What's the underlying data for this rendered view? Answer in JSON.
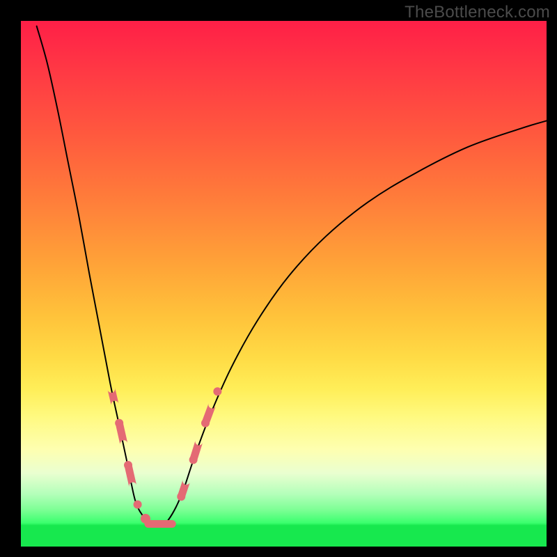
{
  "watermark": "TheBottleneck.com",
  "colors": {
    "background_frame": "#000000",
    "gradient_top": "#ff1f47",
    "gradient_mid1": "#ff7d3a",
    "gradient_mid2": "#ffee58",
    "gradient_bottom_band": "#17e84e",
    "curve_stroke": "#000000",
    "marker_fill": "#e46a74"
  },
  "chart_data": {
    "type": "line",
    "title": "",
    "xlabel": "",
    "ylabel": "",
    "xlim": [
      0,
      100
    ],
    "ylim": [
      0,
      100
    ],
    "note": "Axes unlabeled; values are relative (percent of plot area). x left→right 0–100, y bottom→top 0–100. Two monotone curves forming a V with a flat minimum near x≈22–27 at y≈4.",
    "series": [
      {
        "name": "left-branch",
        "x": [
          3,
          5,
          7,
          9,
          11,
          13,
          15,
          17,
          18.5,
          20,
          21,
          22,
          23.5,
          25,
          26,
          27
        ],
        "y": [
          99,
          92,
          83,
          73,
          63,
          52,
          41.5,
          31,
          24,
          17,
          12,
          8,
          5.5,
          4.5,
          4.2,
          4.1
        ]
      },
      {
        "name": "right-branch",
        "x": [
          27,
          28,
          29.5,
          31,
          33,
          36,
          40,
          45,
          51,
          58,
          66,
          75,
          85,
          95,
          100
        ],
        "y": [
          4.1,
          5,
          7.5,
          11,
          17,
          25,
          34,
          43,
          51.5,
          59,
          65.5,
          71,
          76,
          79.5,
          81
        ]
      }
    ],
    "markers": {
      "description": "Salmon-colored cluster of rounded markers along both branches in the lower ~28% of the plot, plus a short horizontal bar at the valley floor.",
      "left_branch_points": [
        {
          "x": 17.2,
          "y": 30
        },
        {
          "x": 17.9,
          "y": 27
        },
        {
          "x": 18.7,
          "y": 23.5
        },
        {
          "x": 19.6,
          "y": 19.5
        },
        {
          "x": 20.4,
          "y": 15.5
        },
        {
          "x": 21.3,
          "y": 11.5
        },
        {
          "x": 22.2,
          "y": 8
        },
        {
          "x": 23.7,
          "y": 5.3
        }
      ],
      "right_branch_points": [
        {
          "x": 30.5,
          "y": 9.5
        },
        {
          "x": 31.5,
          "y": 12.5
        },
        {
          "x": 32.8,
          "y": 16.5
        },
        {
          "x": 33.9,
          "y": 20
        },
        {
          "x": 35.1,
          "y": 23.5
        },
        {
          "x": 36.4,
          "y": 27
        },
        {
          "x": 37.4,
          "y": 29.5
        }
      ],
      "valley_bar": {
        "x0": 23.5,
        "x1": 29.5,
        "y": 4.3
      }
    }
  }
}
